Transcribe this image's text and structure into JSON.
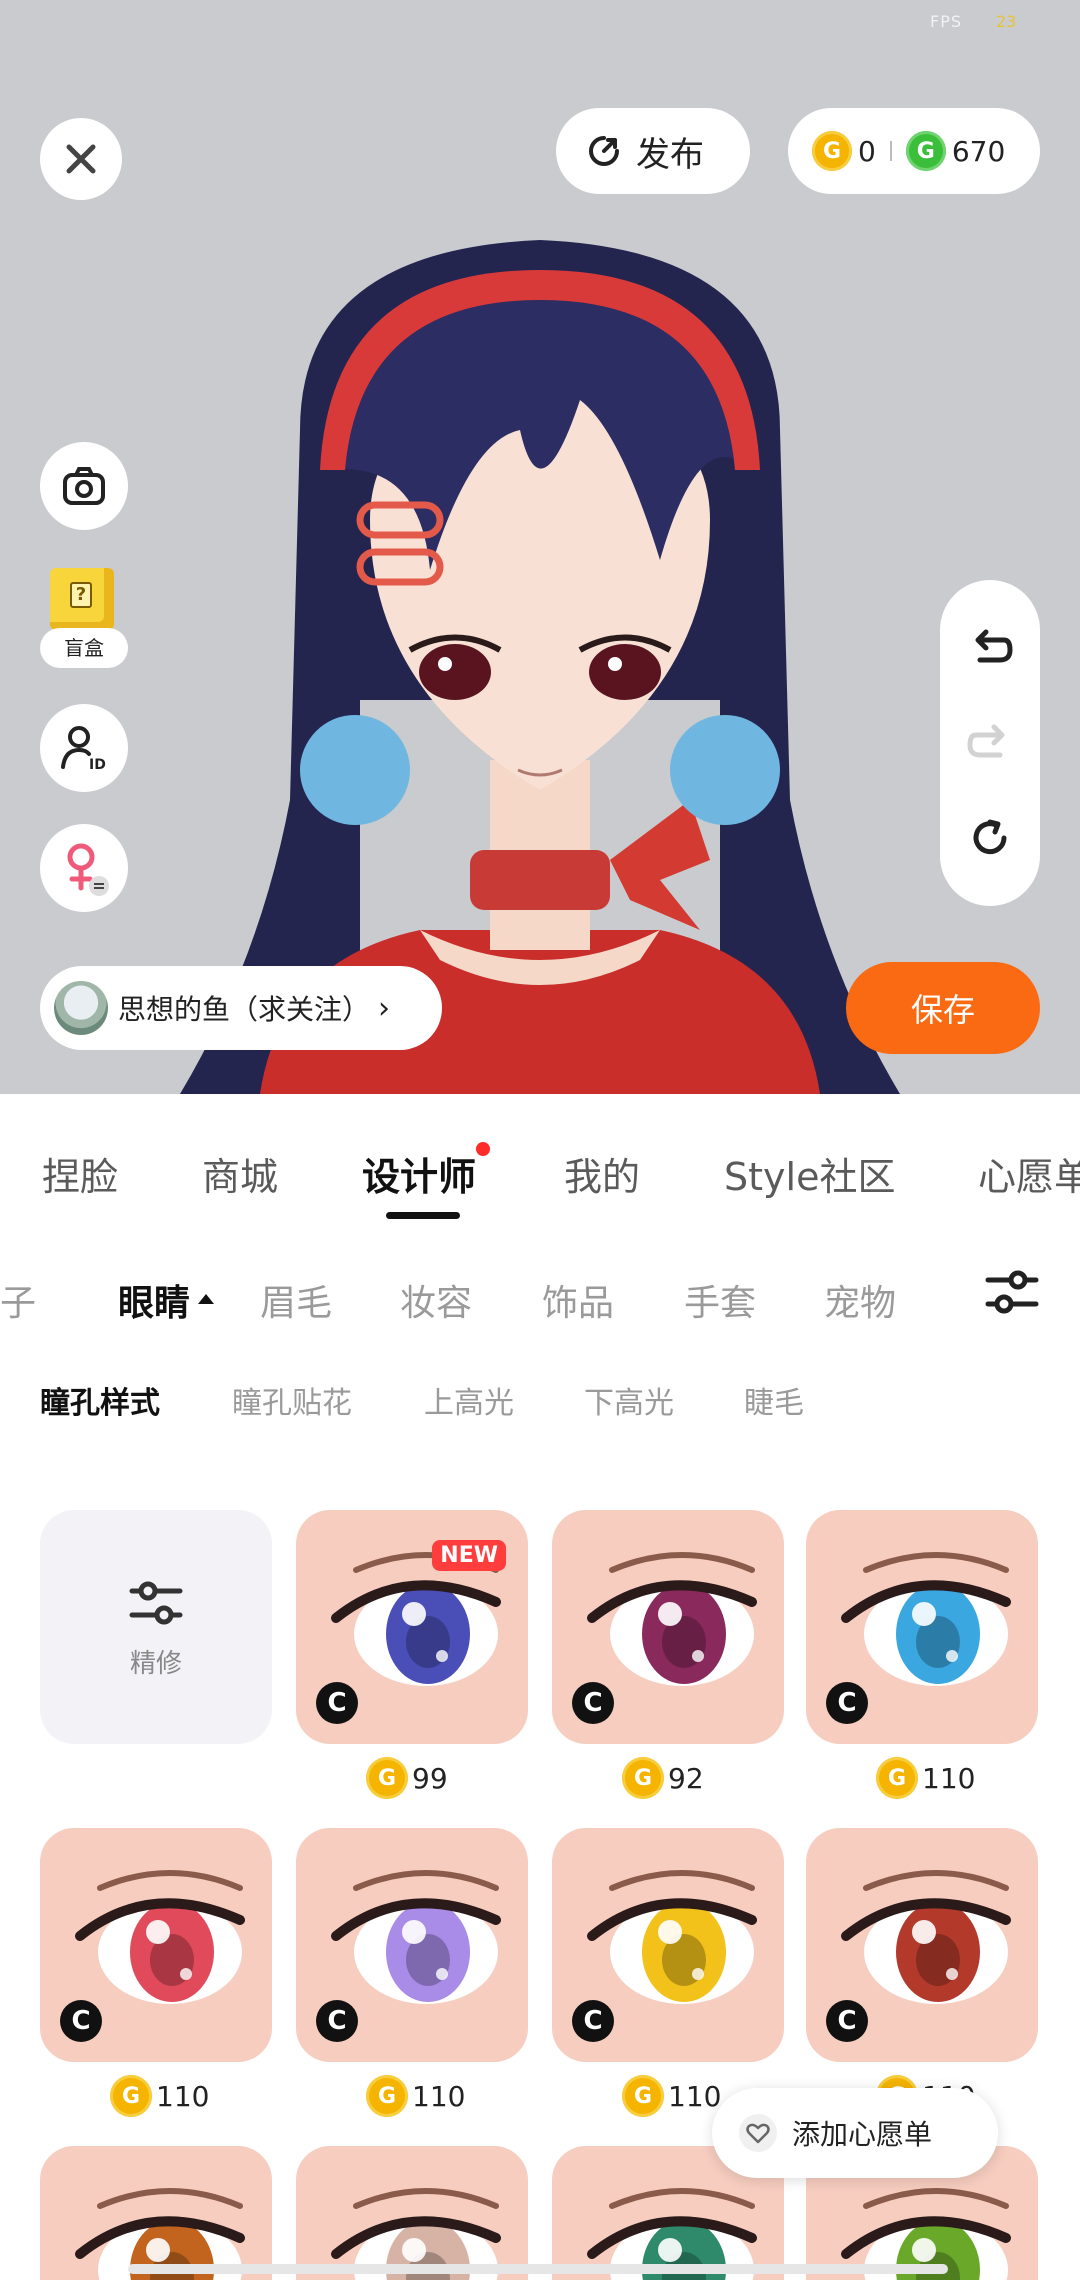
{
  "hud": {
    "fps_label": "FPS",
    "fps_value": "23"
  },
  "top": {
    "publish_label": "发布",
    "gold_coins": "0",
    "green_coins": "670"
  },
  "side": {
    "blindbox_label": "盲盒"
  },
  "author": {
    "name": "思想的鱼（求关注）"
  },
  "save_label": "保存",
  "main_tabs": [
    "捏脸",
    "商城",
    "设计师",
    "我的",
    "Style社区",
    "心愿单"
  ],
  "categories": [
    "鞋子",
    "眼睛",
    "眉毛",
    "妆容",
    "饰品",
    "手套",
    "宠物"
  ],
  "subcategories": [
    "瞳孔样式",
    "瞳孔贴花",
    "上高光",
    "下高光",
    "睫毛"
  ],
  "grid": {
    "refine_label": "精修",
    "new_badge": "NEW",
    "c_badge": "C",
    "coin_letter": "G",
    "items": [
      {
        "price": "99",
        "iris": "#4a4fb8",
        "new": true
      },
      {
        "price": "92",
        "iris": "#8a2a5c",
        "new": false
      },
      {
        "price": "110",
        "iris": "#3aa7e0",
        "new": false
      },
      {
        "price": "110",
        "iris": "#e04a5a",
        "new": false
      },
      {
        "price": "110",
        "iris": "#a98be8",
        "new": false
      },
      {
        "price": "110",
        "iris": "#f2c21a",
        "new": false
      },
      {
        "price": "110",
        "iris": "#b33a2a",
        "new": false
      },
      {
        "price": "",
        "iris": "#c2641e",
        "new": false
      },
      {
        "price": "",
        "iris": "#d7b3a6",
        "new": false
      },
      {
        "price": "",
        "iris": "#2e8a6a",
        "new": false
      },
      {
        "price": "",
        "iris": "#6aa82a",
        "new": false
      }
    ]
  },
  "wishlist_label": "添加心愿单",
  "colors": {
    "accent_orange": "#fa6a12",
    "notify_red": "#ff2b2b",
    "gold": "#f4b400",
    "green": "#3bbf3b"
  }
}
